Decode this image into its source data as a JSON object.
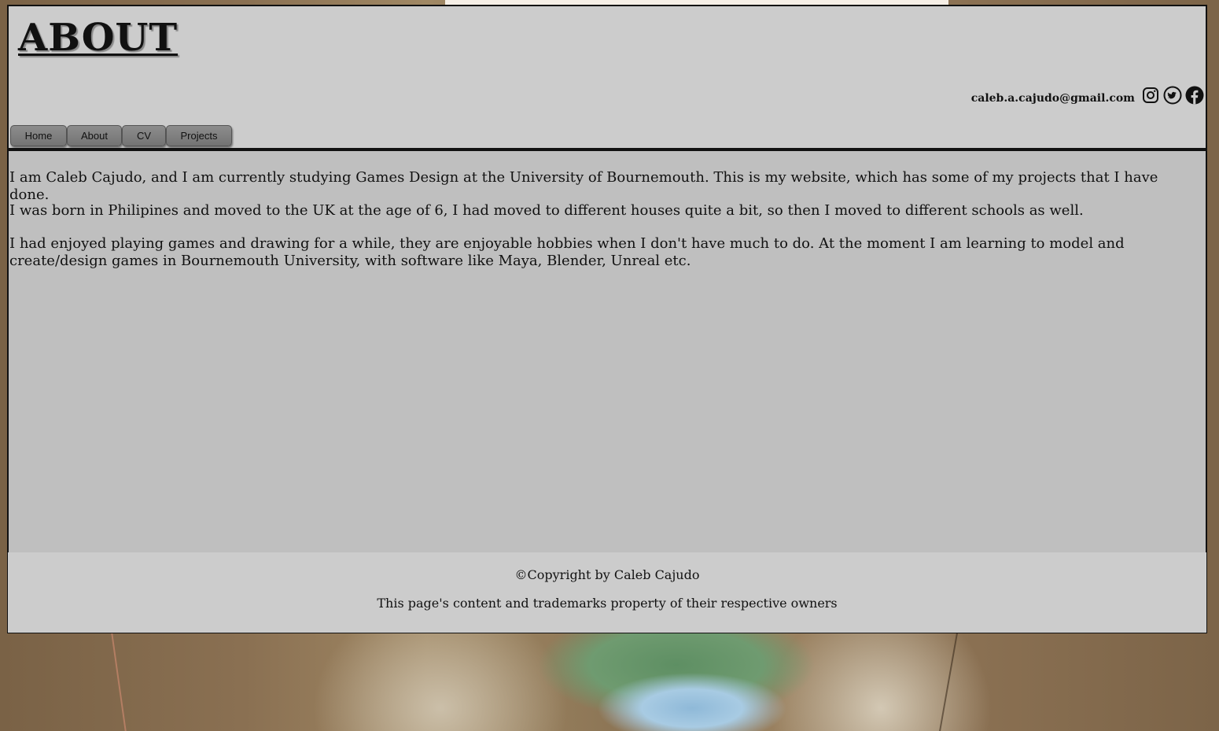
{
  "header": {
    "title": "ABOUT",
    "email": "caleb.a.cajudo@gmail.com",
    "social": [
      {
        "icon": "instagram-icon"
      },
      {
        "icon": "twitter-icon"
      },
      {
        "icon": "facebook-icon"
      }
    ]
  },
  "nav": {
    "items": [
      {
        "label": "Home"
      },
      {
        "label": "About"
      },
      {
        "label": "CV"
      },
      {
        "label": "Projects"
      }
    ]
  },
  "main": {
    "paragraphs": [
      "I am Caleb Cajudo, and I am currently studying Games Design at the University of Bournemouth. This is my website, which has some of my projects that I have done.",
      "I was born in Philipines and moved to the UK at the age of 6, I had moved to different houses quite a bit, so then I moved to different schools as well.",
      "I had enjoyed playing games and drawing for a while, they are enjoyable hobbies when I don't have much to do. At the moment I am learning to model and create/design games in Bournemouth University, with software like Maya, Blender, Unreal etc."
    ]
  },
  "footer": {
    "copyright": "©Copyright by Caleb Cajudo",
    "trademark": "This page's content and trademarks property of their respective owners"
  },
  "colors": {
    "panel": "#cccccc",
    "content": "#bfbfbf",
    "border": "#111111",
    "button": "#808080"
  }
}
